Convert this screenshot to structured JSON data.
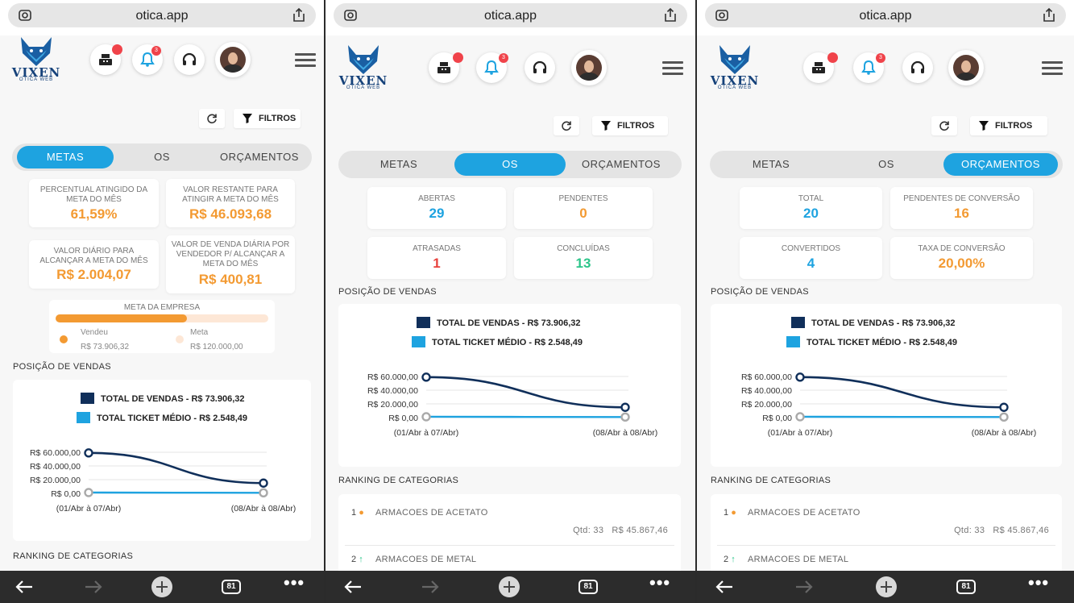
{
  "browser": {
    "url": "otica.app",
    "tabs_count": "81",
    "more": "•••"
  },
  "header": {
    "logo_text": "VIXEN",
    "logo_sub": "OTICA WEB",
    "notification_count": "3",
    "icons": [
      "cash-register-icon",
      "bell-icon",
      "headset-icon",
      "avatar",
      "hamburger-menu-icon"
    ]
  },
  "toolbar": {
    "filter_label": "FILTROS"
  },
  "tabs": [
    "METAS",
    "OS",
    "ORÇAMENTOS"
  ],
  "metas": {
    "cards": [
      {
        "label": "PERCENTUAL ATINGIDO DA META DO MÊS",
        "value": "61,59%"
      },
      {
        "label": "VALOR RESTANTE PARA ATINGIR A META DO MÊS",
        "value": "R$ 46.093,68"
      },
      {
        "label": "VALOR DIÁRIO PARA ALCANÇAR A META DO MÊS",
        "value": "R$ 2.004,07"
      },
      {
        "label": "VALOR DE VENDA DIÁRIA POR VENDEDOR P/ ALCANÇAR A META DO MÊS",
        "value": "R$ 400,81"
      }
    ],
    "meta_empresa": {
      "title": "META DA EMPRESA",
      "progress": 0.6159,
      "sold_label": "Vendeu",
      "sold_value": "R$ 73.906,32",
      "goal_label": "Meta",
      "goal_value": "R$ 120.000,00",
      "sold_color": "#f39a32",
      "goal_color": "#fde7d6"
    }
  },
  "os": {
    "cards": [
      {
        "label": "ABERTAS",
        "value": "29",
        "color": "blue"
      },
      {
        "label": "PENDENTES",
        "value": "0",
        "color": "orange"
      },
      {
        "label": "ATRASADAS",
        "value": "1",
        "color": "red"
      },
      {
        "label": "CONCLUÍDAS",
        "value": "13",
        "color": "green"
      }
    ]
  },
  "orcamentos": {
    "cards": [
      {
        "label": "TOTAL",
        "value": "20",
        "color": "blue"
      },
      {
        "label": "PENDENTES DE CONVERSÃO",
        "value": "16",
        "color": "orange"
      },
      {
        "label": "CONVERTIDOS",
        "value": "4",
        "color": "blue"
      },
      {
        "label": "TAXA DE CONVERSÃO",
        "value": "20,00%",
        "color": "orange"
      }
    ]
  },
  "sales_section_title": "POSIÇÃO DE VENDAS",
  "ranking_section_title": "RANKING DE CATEGORIAS",
  "chart_data": {
    "type": "line",
    "categories": [
      "(01/Abr à 07/Abr)",
      "(08/Abr à 08/Abr)"
    ],
    "series": [
      {
        "name": "TOTAL DE VENDAS - R$ 73.906,32",
        "values": [
          59000,
          15000
        ],
        "color": "#102f5a"
      },
      {
        "name": "TOTAL TICKET MÉDIO - R$ 2.548,49",
        "values": [
          1200,
          800
        ],
        "color": "#1ea3e0"
      }
    ],
    "y_ticks": [
      "R$ 60.000,00",
      "R$ 40.000,00",
      "R$ 20.000,00",
      "R$ 0,00"
    ],
    "ylim": [
      0,
      60000
    ],
    "grid": true,
    "legend": "top"
  },
  "ranking": [
    {
      "rank": "1",
      "trend": "flat",
      "name": "ARMACOES DE ACETATO",
      "qty": "Qtd: 33",
      "value": "R$ 45.867,46"
    },
    {
      "rank": "2",
      "trend": "up",
      "name": "ARMACOES DE METAL"
    }
  ]
}
